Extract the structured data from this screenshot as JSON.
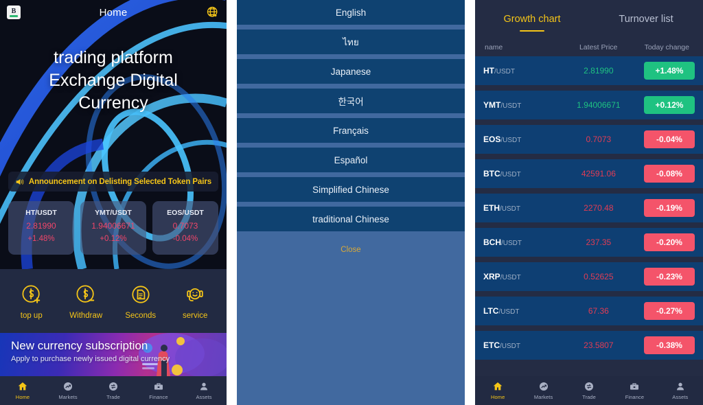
{
  "home": {
    "title": "Home",
    "logo_letter": "B",
    "globe_icon": "globe-icon",
    "hero_lines": [
      "trading platform",
      "Exchange Digital",
      "Currency"
    ],
    "announcement": {
      "icon": "megaphone-icon",
      "text": "Announcement on Delisting Selected Token Pairs"
    },
    "tickers": [
      {
        "pair": "HT/USDT",
        "price": "2.81990",
        "change": "+1.48%"
      },
      {
        "pair": "YMT/USDT",
        "price": "1.94006671",
        "change": "+0.12%"
      },
      {
        "pair": "EOS/USDT",
        "price": "0.7073",
        "change": "-0.04%"
      }
    ],
    "actions": [
      {
        "label": "top up",
        "icon": "dollar-plus-circle-icon"
      },
      {
        "label": "Withdraw",
        "icon": "dollar-minus-circle-icon"
      },
      {
        "label": "Seconds",
        "icon": "document-circle-icon"
      },
      {
        "label": "service",
        "icon": "headset-support-icon"
      }
    ],
    "promo": {
      "title": "New currency subscription",
      "subtitle": "Apply to purchase newly issued digital currency"
    }
  },
  "bottom_nav": {
    "items": [
      {
        "label": "Home",
        "icon": "home-icon",
        "active": true
      },
      {
        "label": "Markets",
        "icon": "chart-arrow-icon",
        "active": false
      },
      {
        "label": "Trade",
        "icon": "exchange-circle-icon",
        "active": false
      },
      {
        "label": "Finance",
        "icon": "briefcase-icon",
        "active": false
      },
      {
        "label": "Assets",
        "icon": "person-icon",
        "active": false
      }
    ]
  },
  "language_sheet": {
    "options": [
      "English",
      "ไทย",
      "Japanese",
      "한국어",
      "Français",
      "Español",
      "Simplified Chinese",
      "traditional Chinese"
    ],
    "close_label": "Close"
  },
  "market": {
    "tabs": [
      {
        "label": "Growth chart",
        "active": true
      },
      {
        "label": "Turnover list",
        "active": false
      }
    ],
    "columns": [
      "name",
      "Latest Price",
      "Today change"
    ],
    "rows": [
      {
        "base": "HT",
        "quote": "/USDT",
        "price": "2.81990",
        "change": "+1.48%",
        "dir": "up"
      },
      {
        "base": "YMT",
        "quote": "/USDT",
        "price": "1.94006671",
        "change": "+0.12%",
        "dir": "up"
      },
      {
        "base": "EOS",
        "quote": "/USDT",
        "price": "0.7073",
        "change": "-0.04%",
        "dir": "down"
      },
      {
        "base": "BTC",
        "quote": "/USDT",
        "price": "42591.06",
        "change": "-0.08%",
        "dir": "down"
      },
      {
        "base": "ETH",
        "quote": "/USDT",
        "price": "2270.48",
        "change": "-0.19%",
        "dir": "down"
      },
      {
        "base": "BCH",
        "quote": "/USDT",
        "price": "237.35",
        "change": "-0.20%",
        "dir": "down"
      },
      {
        "base": "XRP",
        "quote": "/USDT",
        "price": "0.52625",
        "change": "-0.23%",
        "dir": "down"
      },
      {
        "base": "LTC",
        "quote": "/USDT",
        "price": "67.36",
        "change": "-0.27%",
        "dir": "down"
      },
      {
        "base": "ETC",
        "quote": "/USDT",
        "price": "23.5807",
        "change": "-0.38%",
        "dir": "down"
      }
    ]
  },
  "colors": {
    "accent_yellow": "#f5c518",
    "up_green": "#1fc281",
    "down_red": "#f4546a",
    "row_blue": "#0e3f73",
    "panel_navy": "#242c44",
    "lang_sheet_blue": "#41699f",
    "lang_item_blue": "#0f4271"
  }
}
